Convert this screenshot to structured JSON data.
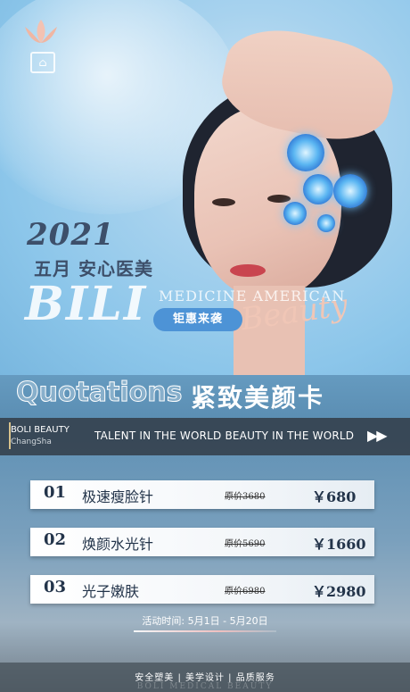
{
  "header": {
    "year": "2021",
    "slogan": "五月 安心医美",
    "brand_big": "BILI",
    "medicine_text": "MEDICINE AMERICAN",
    "beauty_script": "Beauty",
    "promo_tag": "钜惠来袭"
  },
  "banner": {
    "english": "Quotations",
    "chinese": "紧致美颜卡"
  },
  "infobar": {
    "brand_name": "BOLI BEAUTY",
    "brand_city": "ChangSha",
    "tagline": "TALENT IN THE WORLD  BEAUTY IN THE WORLD",
    "arrows": "▶▶"
  },
  "items": [
    {
      "index": "01",
      "name": "极速瘦脸针",
      "original": "原价3680",
      "price": "￥680"
    },
    {
      "index": "02",
      "name": "焕颜水光针",
      "original": "原价5690",
      "price": "￥1660"
    },
    {
      "index": "03",
      "name": "光子嫩肤",
      "original": "原价6980",
      "price": "￥2980"
    }
  ],
  "event": {
    "text": "活动时间: 5月1日 - 5月20日"
  },
  "footer": {
    "text": "安全塑美 | 美学设计 | 品质服务",
    "sub": "BOLI MEDICAL BEAUTY"
  },
  "colors": {
    "navy_text": "#23344a",
    "promo_blue": "#4d93d6",
    "accent_gold": "#d9c38c",
    "flower_blue": "#2a6fd1"
  }
}
